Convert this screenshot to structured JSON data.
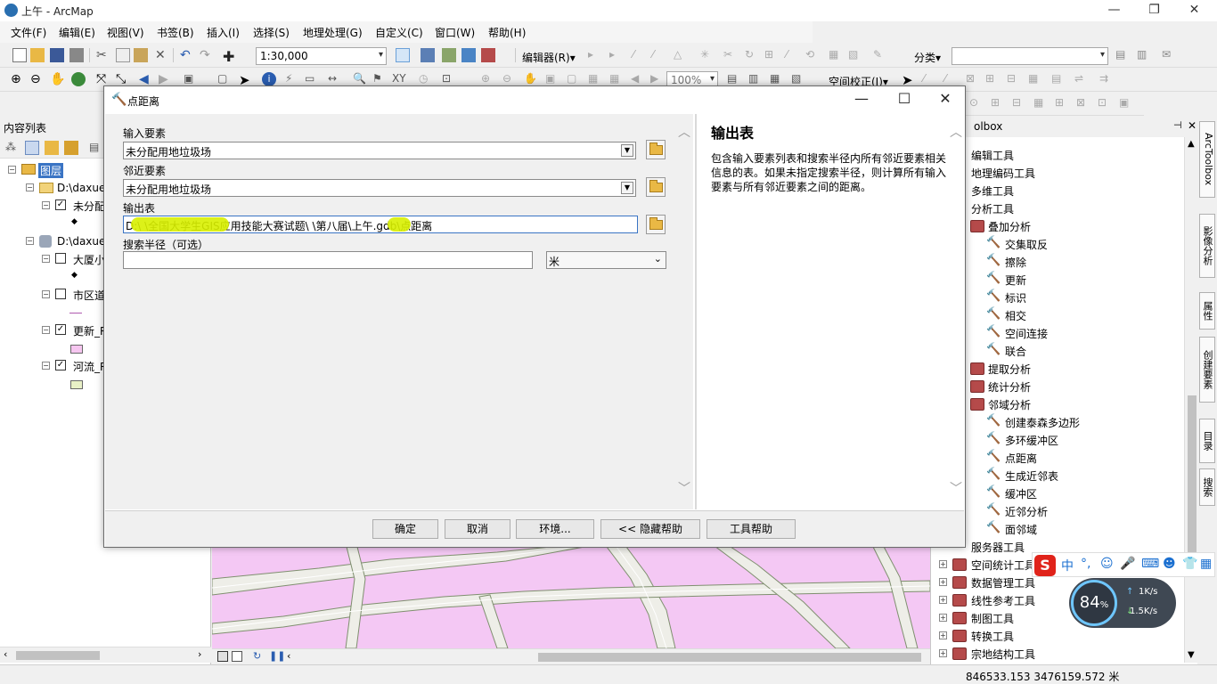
{
  "window": {
    "title": "上午 - ArcMap",
    "minimize": "—",
    "restore": "❐",
    "close": "✕"
  },
  "menubar": {
    "items": [
      "文件(F)",
      "编辑(E)",
      "视图(V)",
      "书签(B)",
      "插入(I)",
      "选择(S)",
      "地理处理(G)",
      "自定义(C)",
      "窗口(W)",
      "帮助(H)"
    ]
  },
  "toolbar": {
    "scale_value": "1:30,000",
    "editor_label": "编辑器(R)▾",
    "classify_label": "分类▾",
    "zoom_value": "100%",
    "georef_label": "空间校正(J)▾"
  },
  "toc": {
    "title": "内容列表",
    "layers_label": "图层",
    "folder1": "D:\\daxue",
    "layer1": "未分配",
    "folder2": "D:\\daxue",
    "layer2": "大厦小",
    "layer3": "市区道",
    "layer4": "更新_R",
    "layer5": "河流_R",
    "colors": {
      "update_swatch": "#f6c6f0",
      "river_swatch": "#e8f0c6"
    }
  },
  "toolbox": {
    "title": "olbox",
    "items": [
      {
        "label": "编辑工具",
        "level": 0
      },
      {
        "label": "地理编码工具",
        "level": 0
      },
      {
        "label": "多维工具",
        "level": 0
      },
      {
        "label": "分析工具",
        "level": 0
      },
      {
        "label": "叠加分析",
        "level": 1
      },
      {
        "label": "交集取反",
        "level": 2
      },
      {
        "label": "擦除",
        "level": 2
      },
      {
        "label": "更新",
        "level": 2
      },
      {
        "label": "标识",
        "level": 2
      },
      {
        "label": "相交",
        "level": 2
      },
      {
        "label": "空间连接",
        "level": 2
      },
      {
        "label": "联合",
        "level": 2
      },
      {
        "label": "提取分析",
        "level": 1
      },
      {
        "label": "统计分析",
        "level": 1
      },
      {
        "label": "邻域分析",
        "level": 1
      },
      {
        "label": "创建泰森多边形",
        "level": 2
      },
      {
        "label": "多环缓冲区",
        "level": 2
      },
      {
        "label": "点距离",
        "level": 2
      },
      {
        "label": "生成近邻表",
        "level": 2
      },
      {
        "label": "缓冲区",
        "level": 2
      },
      {
        "label": "近邻分析",
        "level": 2
      },
      {
        "label": "面邻域",
        "level": 2
      },
      {
        "label": "服务器工具",
        "level": 0
      },
      {
        "label": "空间统计工具",
        "level": 0
      },
      {
        "label": "数据管理工具",
        "level": 0
      },
      {
        "label": "线性参考工具",
        "level": 0
      },
      {
        "label": "制图工具",
        "level": 0
      },
      {
        "label": "转换工具",
        "level": 0
      },
      {
        "label": "宗地结构工具",
        "level": 0
      }
    ]
  },
  "sidetabs": [
    "ArcToolbox",
    "影像分析",
    "属性",
    "创建要素",
    "目录",
    "搜索"
  ],
  "dialog": {
    "title": "点距离",
    "input_features_label": "输入要素",
    "input_features_value": "未分配用地垃圾场",
    "near_features_label": "邻近要素",
    "near_features_value": "未分配用地垃圾场",
    "output_table_label": "输出表",
    "output_table_value": "D:\\              \\全国大学生GIS应用技能大赛试题\\    \\第八届\\上午.gdb\\点距离",
    "search_radius_label": "搜索半径（可选）",
    "search_radius_value": "",
    "units_value": "米",
    "buttons": {
      "ok": "确定",
      "cancel": "取消",
      "env": "环境...",
      "hide_help": "<< 隐藏帮助",
      "tool_help": "工具帮助"
    },
    "help": {
      "title": "输出表",
      "body": "包含输入要素列表和搜索半径内所有邻近要素相关信息的表。如果未指定搜索半径，则计算所有输入要素与所有邻近要素之间的距离。"
    }
  },
  "ime": {
    "logo": "S",
    "mode": "中",
    "punct": "°,"
  },
  "speed": {
    "percent": "84",
    "percent_unit": "%",
    "upload": "1K/s",
    "download": "1.5K/s"
  },
  "status": {
    "coords": "846533.153  3476159.572 米"
  }
}
